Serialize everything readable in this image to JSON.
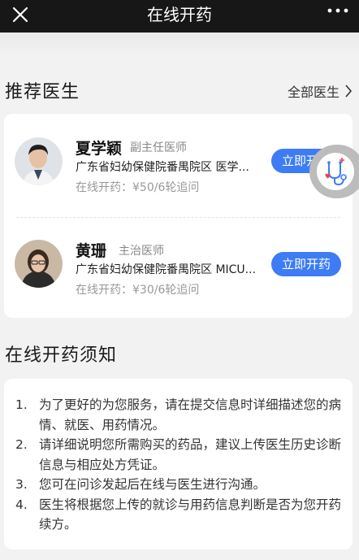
{
  "header": {
    "title": "在线开药"
  },
  "recommend": {
    "title": "推荐医生",
    "all_label": "全部医生"
  },
  "doctors": [
    {
      "name": "夏学颖",
      "title": "副主任医师",
      "hospital": "广东省妇幼保健院番禺院区 医学...",
      "price": "在线开药：¥50/6轮追问",
      "button": "立即开药"
    },
    {
      "name": "黄珊",
      "title": "主治医师",
      "hospital": "广东省妇幼保健院番禺院区 MICU...",
      "price": "在线开药：¥30/6轮追问",
      "button": "立即开药"
    }
  ],
  "notice": {
    "title": "在线开药须知",
    "items": [
      {
        "num": "1.",
        "text": "为了更好的为您服务，请在提交信息时详细描述您的病情、就医、用药情况。"
      },
      {
        "num": "2.",
        "text": "请详细说明您所需购买的药品，建议上传医生历史诊断信息与相应处方凭证。"
      },
      {
        "num": "3.",
        "text": "您可在问诊发起后在线与医生进行沟通。"
      },
      {
        "num": "4.",
        "text": "医生将根据您上传的就诊与用药信息判断是否为您开药续方。"
      }
    ]
  },
  "colors": {
    "accent": "#3d7cf4",
    "topbar": "#171717",
    "background": "#f2f2f2"
  },
  "icons": {
    "close": "close-icon",
    "more": "more-icon",
    "chevron": "chevron-right-icon",
    "assistant": "doctor-assistant-icon"
  }
}
